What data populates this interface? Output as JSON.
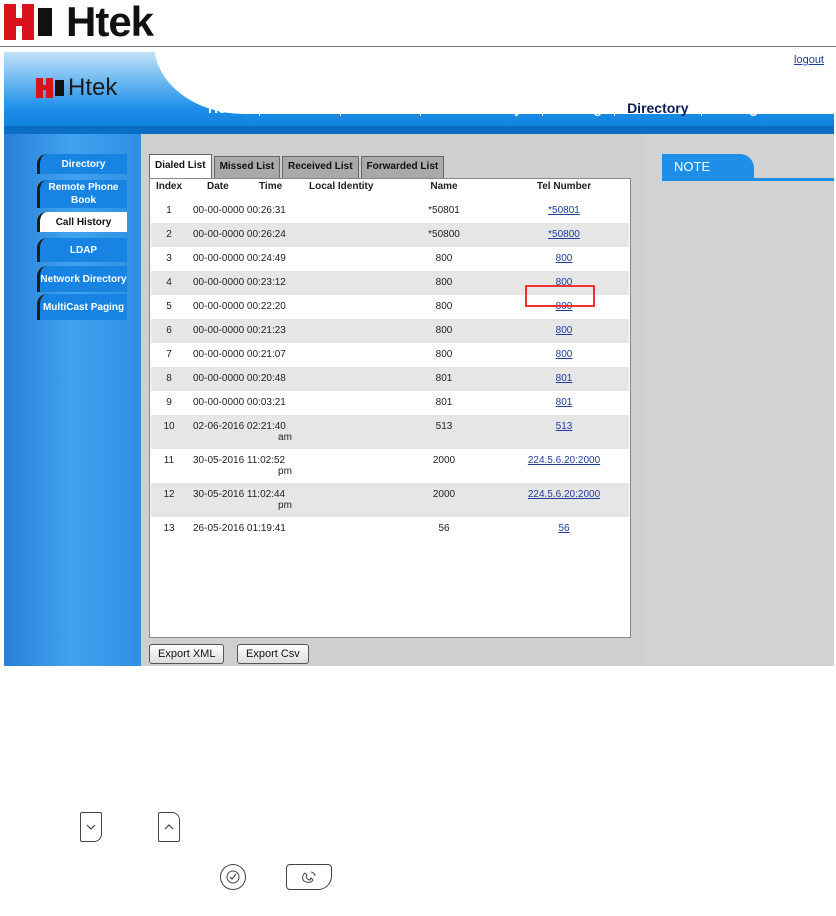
{
  "brand": {
    "name": "Htek",
    "accent": "#d9121b",
    "nav_blue": "#1784e4"
  },
  "header": {
    "logout": "logout",
    "nav": [
      {
        "label": "Home",
        "active": false
      },
      {
        "label": "Account",
        "active": false
      },
      {
        "label": "Network",
        "active": false
      },
      {
        "label": "Function Keys",
        "active": false
      },
      {
        "label": "Setting",
        "active": false
      },
      {
        "label": "Directory",
        "active": true
      },
      {
        "label": "Management",
        "active": false
      }
    ]
  },
  "sidebar": {
    "items": [
      {
        "label": "Directory",
        "active": false
      },
      {
        "label": "Remote Phone Book",
        "active": false
      },
      {
        "label": "Call History",
        "active": true
      },
      {
        "label": "LDAP",
        "active": false
      },
      {
        "label": "Network Directory",
        "active": false
      },
      {
        "label": "MultiCast Paging",
        "active": false
      }
    ]
  },
  "tabs": [
    {
      "label": "Dialed List",
      "active": true
    },
    {
      "label": "Missed List",
      "active": false
    },
    {
      "label": "Received List",
      "active": false
    },
    {
      "label": "Forwarded List",
      "active": false
    }
  ],
  "table": {
    "headers": {
      "index": "Index",
      "date": "Date",
      "time": "Time",
      "local": "Local Identity",
      "name": "Name",
      "tel": "Tel Number"
    },
    "rows": [
      {
        "index": "1",
        "datetime": "00-00-0000 00:26:31",
        "ampm": "",
        "name": "*50801",
        "tel": "*50801"
      },
      {
        "index": "2",
        "datetime": "00-00-0000 00:26:24",
        "ampm": "",
        "name": "*50800",
        "tel": "*50800"
      },
      {
        "index": "3",
        "datetime": "00-00-0000 00:24:49",
        "ampm": "",
        "name": "800",
        "tel": "800"
      },
      {
        "index": "4",
        "datetime": "00-00-0000 00:23:12",
        "ampm": "",
        "name": "800",
        "tel": "800"
      },
      {
        "index": "5",
        "datetime": "00-00-0000 00:22:20",
        "ampm": "",
        "name": "800",
        "tel": "800"
      },
      {
        "index": "6",
        "datetime": "00-00-0000 00:21:23",
        "ampm": "",
        "name": "800",
        "tel": "800"
      },
      {
        "index": "7",
        "datetime": "00-00-0000 00:21:07",
        "ampm": "",
        "name": "800",
        "tel": "800"
      },
      {
        "index": "8",
        "datetime": "00-00-0000 00:20:48",
        "ampm": "",
        "name": "801",
        "tel": "801"
      },
      {
        "index": "9",
        "datetime": "00-00-0000 00:03:21",
        "ampm": "",
        "name": "801",
        "tel": "801"
      },
      {
        "index": "10",
        "datetime": "02-06-2016 02:21:40",
        "ampm": "am",
        "name": "513",
        "tel": "513"
      },
      {
        "index": "11",
        "datetime": "30-05-2016 11:02:52",
        "ampm": "pm",
        "name": "2000",
        "tel": "224.5.6.20:2000"
      },
      {
        "index": "12",
        "datetime": "30-05-2016 11:02:44",
        "ampm": "pm",
        "name": "2000",
        "tel": "224.5.6.20:2000"
      },
      {
        "index": "13",
        "datetime": "26-05-2016 01:19:41",
        "ampm": "",
        "name": "56",
        "tel": "56"
      }
    ]
  },
  "buttons": {
    "export_xml": "Export XML",
    "export_csv": "Export Csv"
  },
  "note": {
    "title": "NOTE"
  }
}
